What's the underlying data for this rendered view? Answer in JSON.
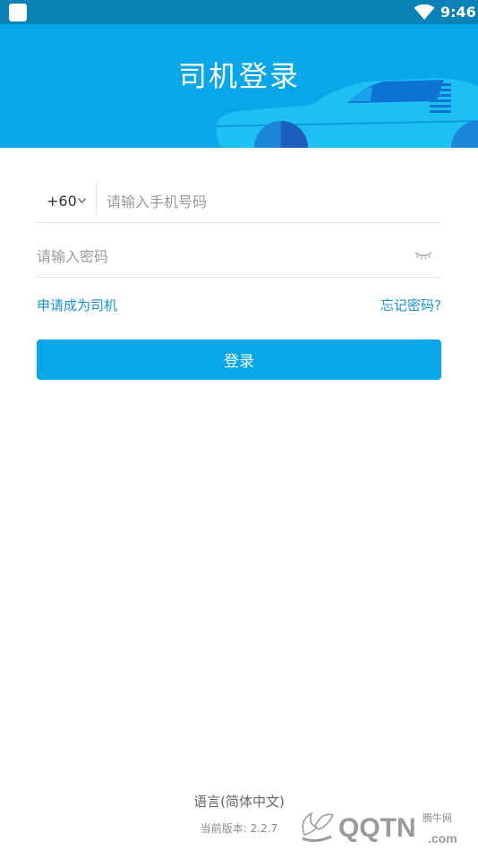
{
  "status_bar": {
    "time": "9:46",
    "wifi_icon": "wifi-icon",
    "app_icon": "app-notification-icon"
  },
  "header": {
    "title": "司机登录",
    "background_color": "#07a7e9",
    "illustration": "car-illustration"
  },
  "login_form": {
    "country_code": "+60",
    "country_code_icon": "chevron-down-icon",
    "phone_placeholder": "请输入手机号码",
    "phone_value": "",
    "password_placeholder": "请输入密码",
    "password_value": "",
    "password_toggle_icon": "eye-closed-icon",
    "apply_driver_link": "申请成为司机",
    "forgot_password_link": "忘记密码?",
    "login_button": "登录",
    "accent_color": "#07a7e9",
    "link_color": "#1493d4"
  },
  "footer": {
    "language": "语言(简体中文)",
    "version": "当前版本: 2.2.7"
  },
  "watermark": {
    "brand": "QQTN",
    "site_name": "腾牛网",
    "domain": ".com"
  }
}
